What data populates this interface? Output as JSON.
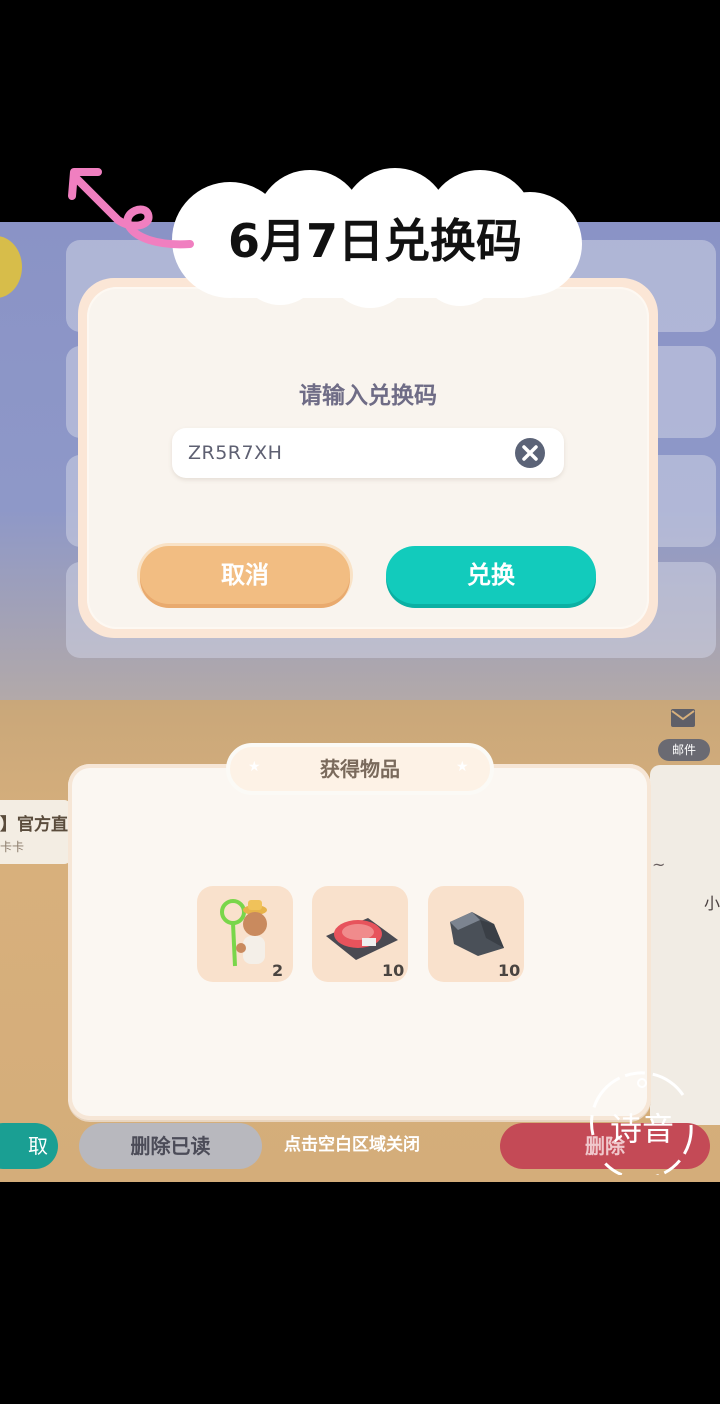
{
  "overlay_title": "6月7日兑换码",
  "redeem_dialog": {
    "prompt": "请输入兑换码",
    "code_value": "ZR5R7XH",
    "cancel_label": "取消",
    "redeem_label": "兑换"
  },
  "rewards_panel": {
    "title": "获得物品",
    "items": [
      {
        "icon": "bug-net-character-icon",
        "count": "2"
      },
      {
        "icon": "steak-meat-icon",
        "count": "10"
      },
      {
        "icon": "stone-ore-icon",
        "count": "10"
      }
    ],
    "close_hint": "点击空白区域关闭"
  },
  "mailbox_bg": {
    "mail_label": "邮件",
    "left_card_text": "】官方直",
    "left_card_sub": "卡卡",
    "right_card_text": "小",
    "claim_label": "取",
    "delete_read_label": "删除已读",
    "delete_label": "删除"
  },
  "watermark_text": "诗音",
  "colors": {
    "redeem_button": "#12cbbc",
    "cancel_button": "#f2bd82",
    "arrow": "#f07fc0"
  }
}
